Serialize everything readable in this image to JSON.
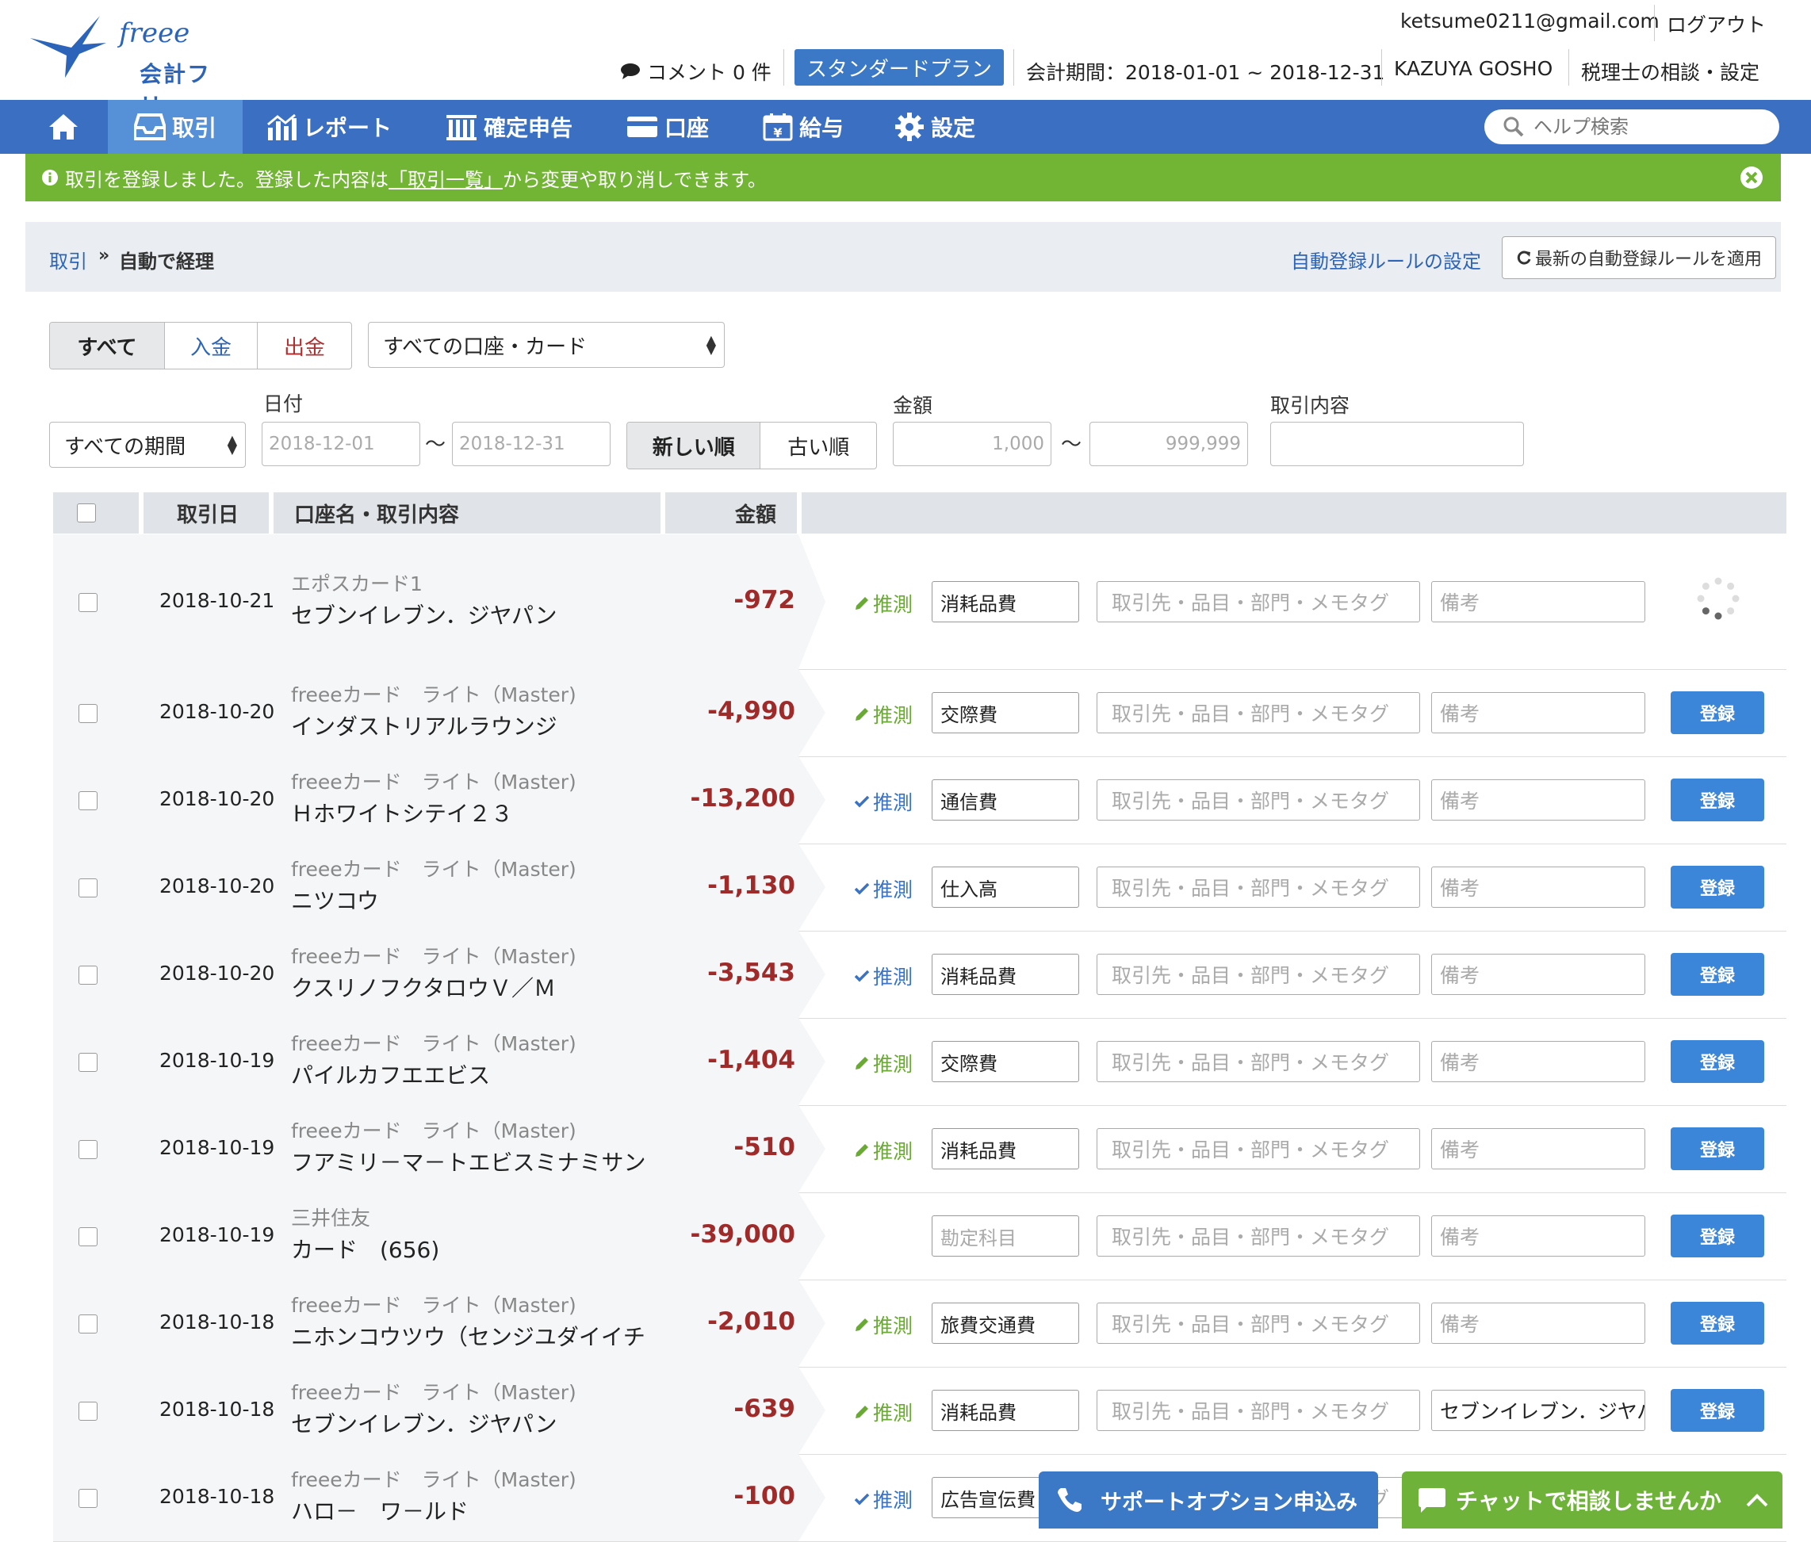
{
  "header": {
    "logo_text": "会計フリー",
    "logo_script": "freee",
    "email": "ketsume0211@gmail.com",
    "logout": "ログアウト",
    "comment": "コメント 0 件",
    "plan": "スタンダードプラン",
    "period": "会計期間：2018-01-01 ~ 2018-12-31",
    "user_name": "KAZUYA GOSHO",
    "tax_advisor": "税理士の相談・設定"
  },
  "nav": {
    "items": [
      {
        "label": "取引"
      },
      {
        "label": "レポート"
      },
      {
        "label": "確定申告"
      },
      {
        "label": "口座"
      },
      {
        "label": "給与"
      },
      {
        "label": "設定"
      }
    ],
    "search_placeholder": "ヘルプ検索"
  },
  "alert": {
    "before": "取引を登録しました。登録した内容は",
    "link": "「取引一覧」",
    "after": "から変更や取り消しできます。"
  },
  "breadcrumb": {
    "parent": "取引",
    "separator": "»",
    "current": "自動で経理",
    "rule_settings": "自動登録ルールの設定",
    "apply_rules": "最新の自動登録ルールを適用"
  },
  "filters": {
    "type_tabs": [
      "すべて",
      "入金",
      "出金"
    ],
    "account_select": "すべての口座・カード",
    "period_select": "すべての期間",
    "date_label": "日付",
    "date_from_placeholder": "2018-12-01",
    "date_to_placeholder": "2018-12-31",
    "tilde": "〜",
    "sort_tabs": [
      "新しい順",
      "古い順"
    ],
    "amount_label": "金額",
    "amount_from_placeholder": "1,000",
    "amount_to_placeholder": "999,999",
    "content_label": "取引内容",
    "content_placeholder": ""
  },
  "table": {
    "headers": {
      "date": "取引日",
      "account": "口座名・取引内容",
      "amount": "金額"
    },
    "tag_placeholder": "取引先・品目・部門・メモタグ",
    "memo_placeholder": "備考",
    "account_placeholder": "勘定科目",
    "register": "登録",
    "guess_label": "推測",
    "rows": [
      {
        "date": "2018-10-21",
        "account": "エポスカード1",
        "desc": "セブンイレブン．ジヤパン",
        "amount": "-972",
        "guess": "pencil",
        "category": "消耗品費",
        "memo": "",
        "status": "loading"
      },
      {
        "date": "2018-10-20",
        "account": "freeeカード　ライト（Master)",
        "desc": "インダストリアルラウンジ",
        "amount": "-4,990",
        "guess": "pencil",
        "category": "交際費",
        "memo": "",
        "status": "button"
      },
      {
        "date": "2018-10-20",
        "account": "freeeカード　ライト（Master)",
        "desc": "Ｈホワイトシテイ２３",
        "amount": "-13,200",
        "guess": "check",
        "category": "通信費",
        "memo": "",
        "status": "button"
      },
      {
        "date": "2018-10-20",
        "account": "freeeカード　ライト（Master)",
        "desc": "ニツコウ",
        "amount": "-1,130",
        "guess": "check",
        "category": "仕入高",
        "memo": "",
        "status": "button"
      },
      {
        "date": "2018-10-20",
        "account": "freeeカード　ライト（Master)",
        "desc": "クスリノフクタロウＶ／Ｍ",
        "amount": "-3,543",
        "guess": "check",
        "category": "消耗品費",
        "memo": "",
        "status": "button"
      },
      {
        "date": "2018-10-19",
        "account": "freeeカード　ライト（Master)",
        "desc": "パイルカフエエビス",
        "amount": "-1,404",
        "guess": "pencil",
        "category": "交際費",
        "memo": "",
        "status": "button"
      },
      {
        "date": "2018-10-19",
        "account": "freeeカード　ライト（Master)",
        "desc": "フアミリ－マ－トエビスミナミサン",
        "amount": "-510",
        "guess": "pencil",
        "category": "消耗品費",
        "memo": "",
        "status": "button"
      },
      {
        "date": "2018-10-19",
        "account": "三井住友",
        "desc": "カード　(656)",
        "amount": "-39,000",
        "guess": "none",
        "category": "",
        "memo": "",
        "status": "button"
      },
      {
        "date": "2018-10-18",
        "account": "freeeカード　ライト（Master)",
        "desc": "ニホンコウツウ（センジユダイイチ",
        "amount": "-2,010",
        "guess": "pencil",
        "category": "旅費交通費",
        "memo": "",
        "status": "button"
      },
      {
        "date": "2018-10-18",
        "account": "freeeカード　ライト（Master)",
        "desc": "セブンイレブン．ジヤパン",
        "amount": "-639",
        "guess": "pencil",
        "category": "消耗品費",
        "memo": "セブンイレブン．ジヤパ",
        "status": "button"
      },
      {
        "date": "2018-10-18",
        "account": "freeeカード　ライト（Master)",
        "desc": "ハロ－　ワ－ルド",
        "amount": "-100",
        "guess": "check",
        "category": "広告宣伝費",
        "memo": "",
        "status": "button"
      }
    ]
  },
  "floating": {
    "support": "サポートオプション申込み",
    "chat": "チャットで相談しませんか"
  },
  "colors": {
    "nav": "#3b6fc2",
    "alert": "#72b434",
    "amount": "#9e2a2a",
    "register_button": "#3b86d8"
  }
}
